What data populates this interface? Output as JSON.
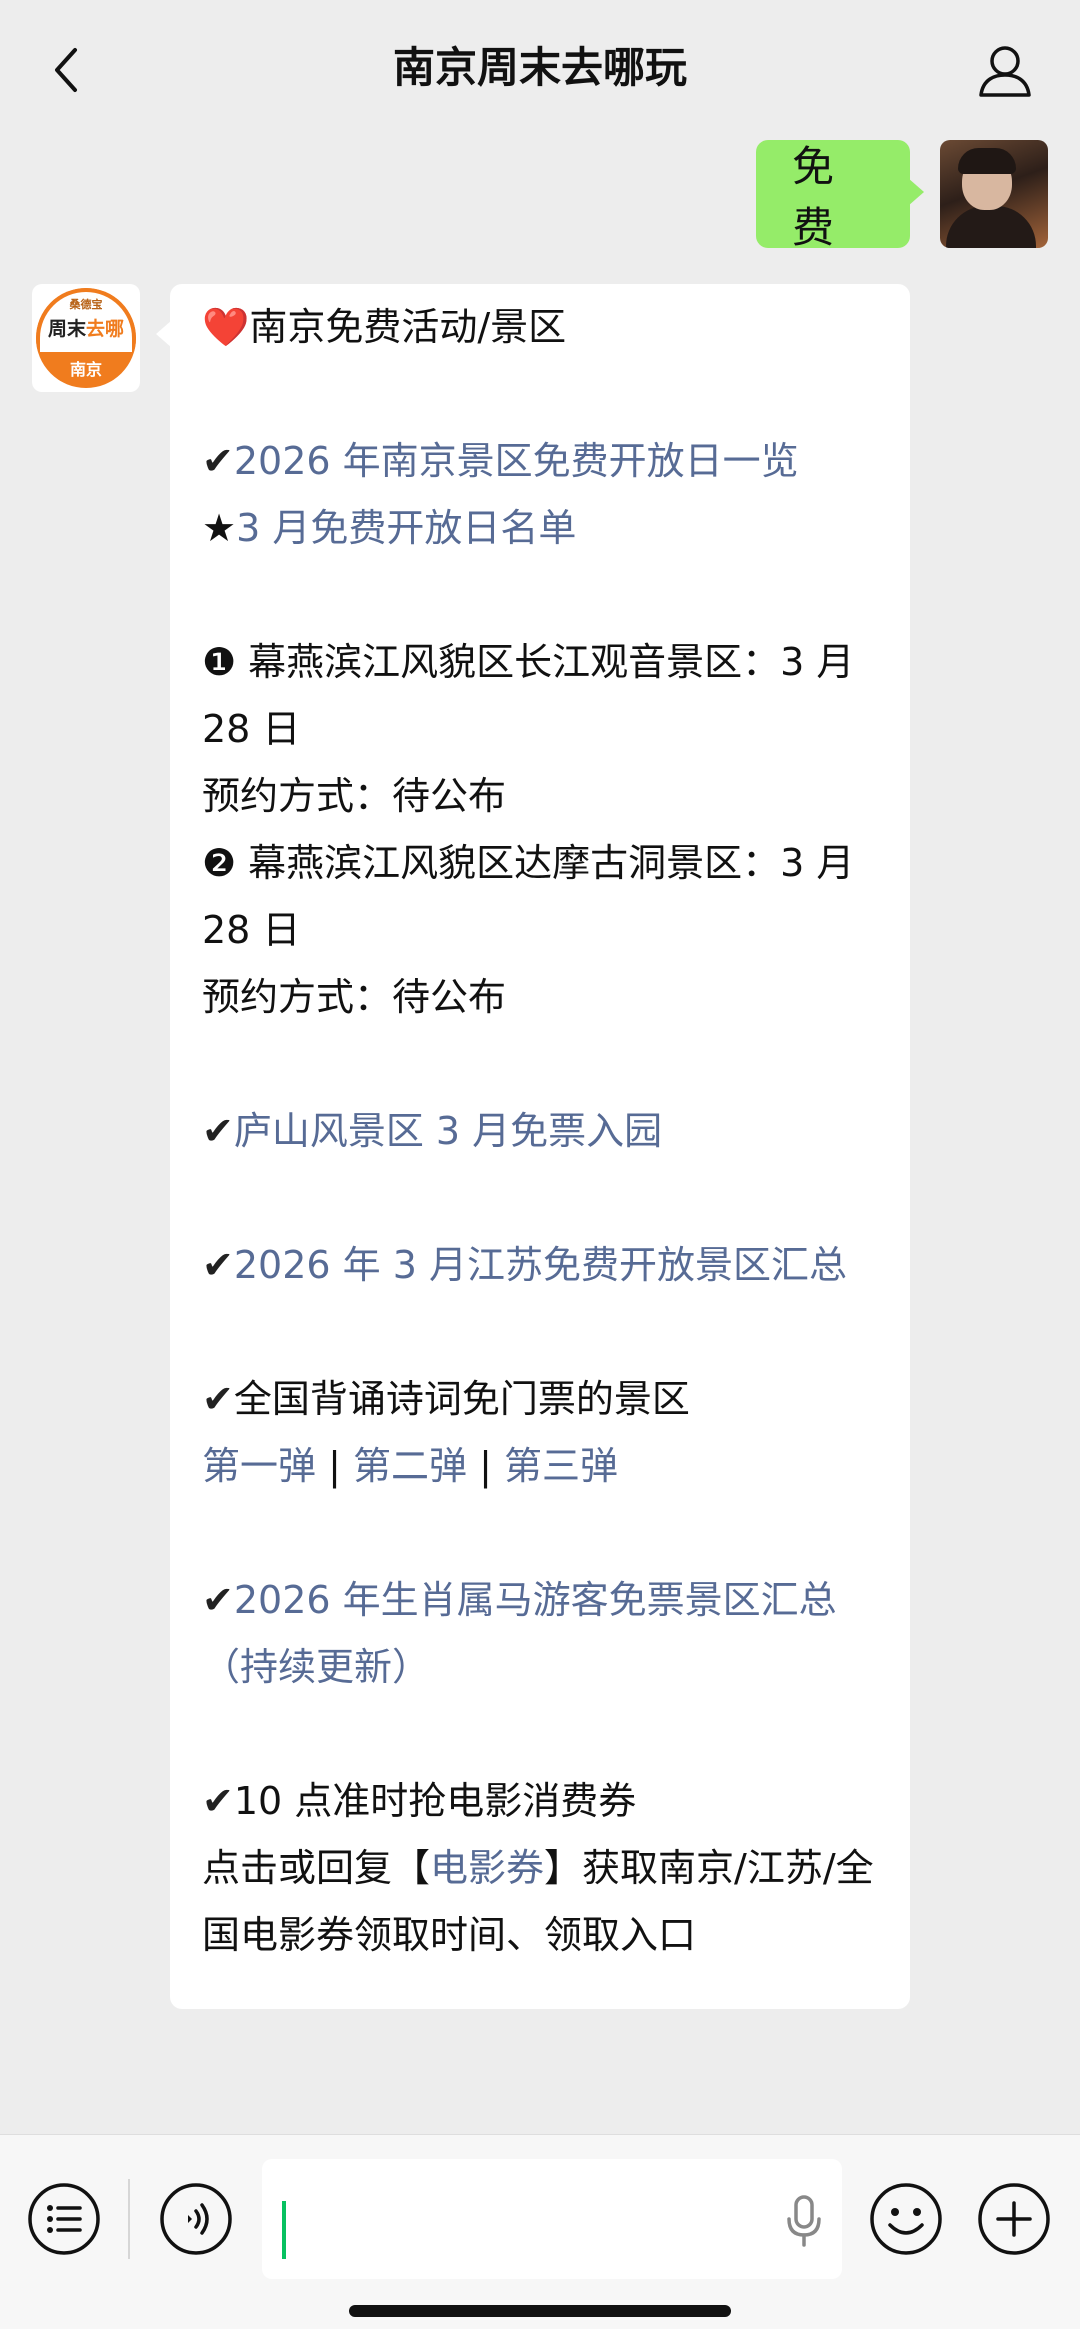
{
  "header": {
    "title": "南京周末去哪玩"
  },
  "sent_message": {
    "text": "免费"
  },
  "bot": {
    "logo_small": "桑德宝",
    "logo_main_a": "周末",
    "logo_main_b": "去哪",
    "logo_city": "南京"
  },
  "reply": {
    "l1": "南京免费活动/景区",
    "l1_icon": "❤️",
    "l2_check": "✔",
    "l2_link": "2026 年南京景区免费开放日一览",
    "l3_star": "★",
    "l3_link": "3 月免费开放日名单",
    "l4": "❶ 幕燕滨江风貌区长江观音景区：3 月 28 日",
    "l5": "预约方式：待公布",
    "l6": "❷ 幕燕滨江风貌区达摩古洞景区：3 月 28 日",
    "l7": "预约方式：待公布",
    "l8_check": "✔",
    "l8_link": "庐山风景区 3 月免票入园",
    "l9_check": "✔",
    "l9_link": "2026 年 3 月江苏免费开放景区汇总",
    "l10_check": "✔",
    "l10": "全国背诵诗词免门票的景区",
    "l11_a": "第一弹",
    "l11_sep1": " | ",
    "l11_b": "第二弹",
    "l11_sep2": "  | ",
    "l11_c": "第三弹",
    "l12_check": "✔",
    "l12_link": "2026 年生肖属马游客免票景区汇总（持续更新）",
    "l13_check": "✔",
    "l13": "10 点准时抢电影消费券",
    "l14_a": "点击或回复【",
    "l14_link": "电影券",
    "l14_b": "】获取南京/江苏/全国电影券领取时间、领取入口"
  },
  "colors": {
    "link": "#576b95",
    "bubble_out": "#95ec69",
    "accent": "#07c160"
  },
  "icons": {
    "back": "chevron-left-icon",
    "profile": "person-icon",
    "list": "list-menu-icon",
    "voice": "voice-icon",
    "mic": "microphone-icon",
    "emoji": "smile-icon",
    "plus": "plus-icon"
  }
}
